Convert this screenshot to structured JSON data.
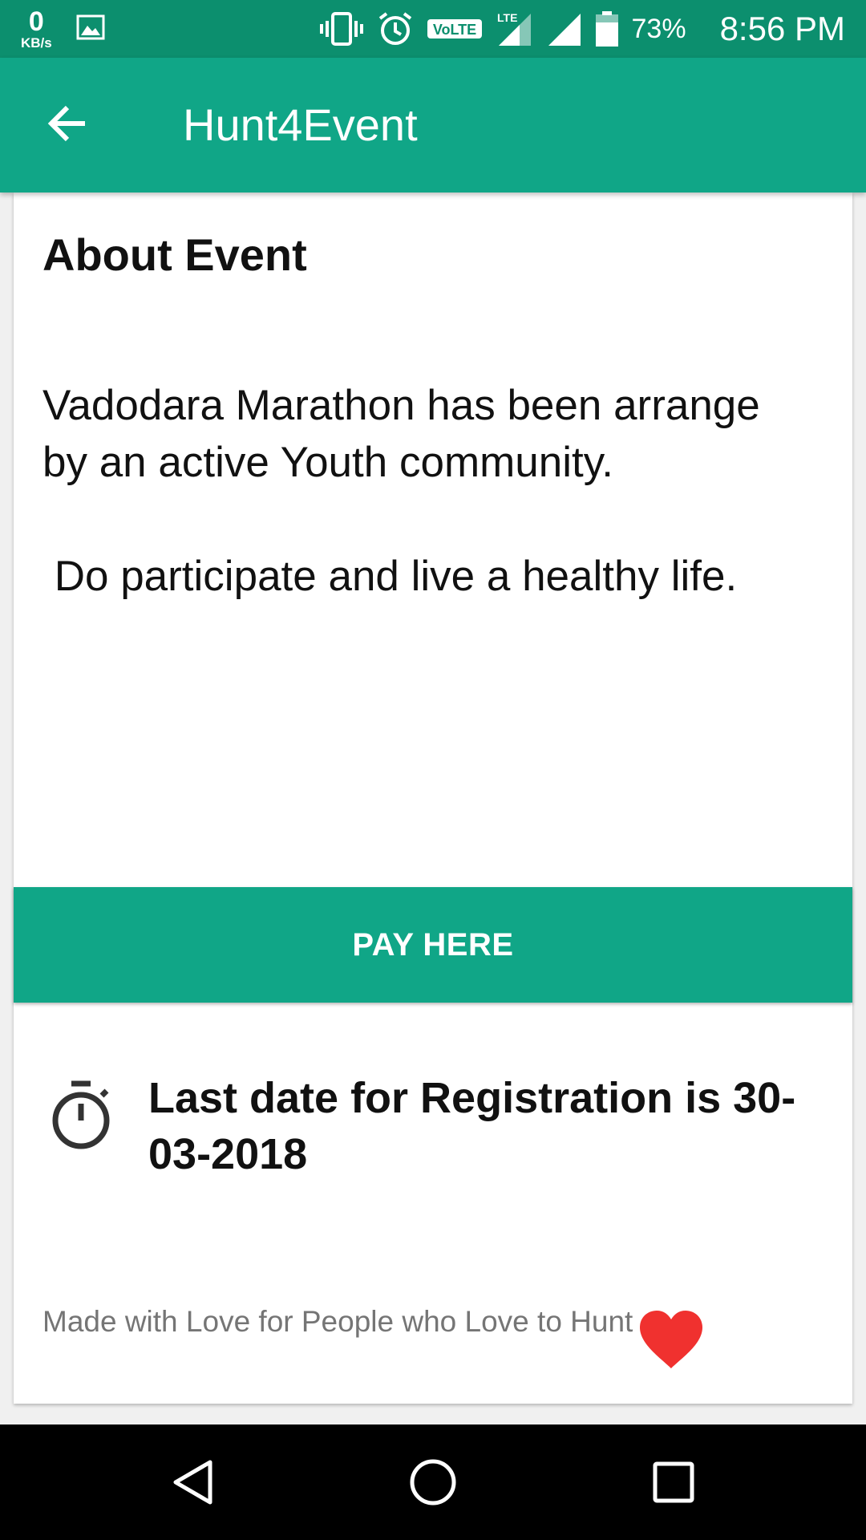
{
  "status_bar": {
    "net_speed_value": "0",
    "net_speed_unit": "KB/s",
    "network_type": "LTE",
    "volte_label": "VoLTE",
    "battery_percent": "73%",
    "time": "8:56 PM",
    "icons": [
      "gallery-icon",
      "vibrate-icon",
      "alarm-icon",
      "volte-icon",
      "lte-signal-icon",
      "signal-icon",
      "battery-icon"
    ]
  },
  "app_bar": {
    "title": "Hunt4Event",
    "back_icon": "arrow-back-icon"
  },
  "about": {
    "heading": "About Event",
    "body": "Vadodara Marathon has been arrange by an active Youth community.\n\n Do participate and live a healthy life."
  },
  "pay_button": {
    "label": "PAY HERE"
  },
  "registration": {
    "icon": "timer-icon",
    "text": "Last date for Registration is 30-03-2018"
  },
  "footer": {
    "text": "Made with Love for People who Love to Hunt",
    "icon": "heart-icon"
  },
  "nav_bar": {
    "buttons": [
      "back-triangle-icon",
      "home-circle-icon",
      "recents-square-icon"
    ]
  },
  "colors": {
    "status_bar": "#0c8f6e",
    "primary": "#10a687",
    "heart": "#f0312f",
    "footer_text": "#757575"
  }
}
